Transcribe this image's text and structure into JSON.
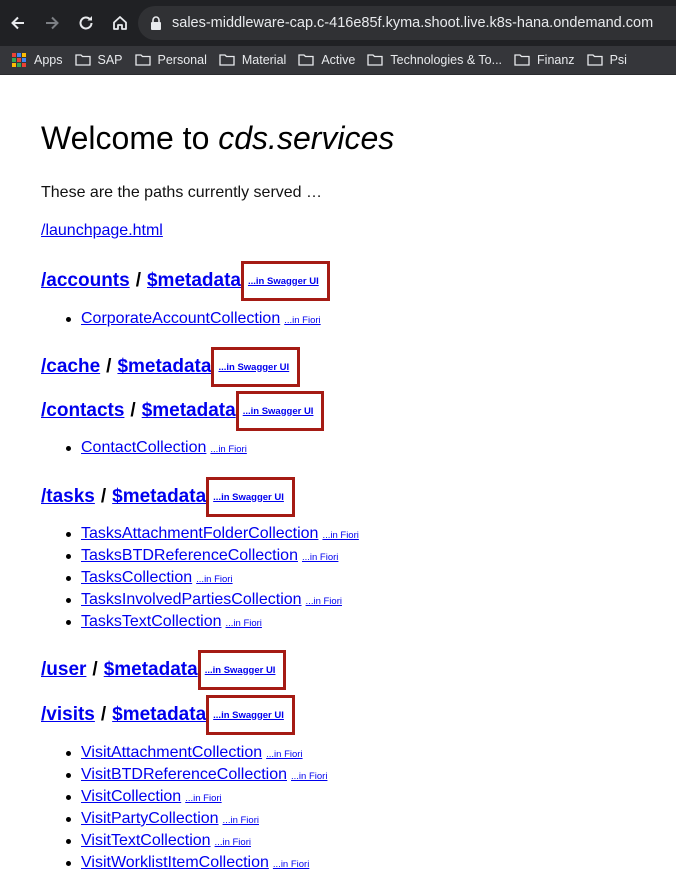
{
  "browser": {
    "url": "sales-middleware-cap.c-416e85f.kyma.shoot.live.k8s-hana.ondemand.com",
    "bookmarks": [
      "Apps",
      "SAP",
      "Personal",
      "Material",
      "Active",
      "Technologies & To...",
      "Finanz",
      "Psi"
    ]
  },
  "page": {
    "title_prefix": "Welcome to ",
    "title_em": "cds.services",
    "intro": "These are the paths currently served …",
    "launch_link": "/launchpage.html",
    "metadata_label": "$metadata",
    "slash": "/",
    "swagger_label": "...in Swagger UI",
    "fiori_label": "...in Fiori"
  },
  "services": [
    {
      "path": "/accounts",
      "entities": [
        "CorporateAccountCollection"
      ]
    },
    {
      "path": "/cache",
      "entities": []
    },
    {
      "path": "/contacts",
      "entities": [
        "ContactCollection"
      ]
    },
    {
      "path": "/tasks",
      "entities": [
        "TasksAttachmentFolderCollection",
        "TasksBTDReferenceCollection",
        "TasksCollection",
        "TasksInvolvedPartiesCollection",
        "TasksTextCollection"
      ]
    },
    {
      "path": "/user",
      "entities": []
    },
    {
      "path": "/visits",
      "entities": [
        "VisitAttachmentCollection",
        "VisitBTDReferenceCollection",
        "VisitCollection",
        "VisitPartyCollection",
        "VisitTextCollection",
        "VisitWorklistItemCollection"
      ]
    }
  ],
  "colors": {
    "link": "#0000ee",
    "highlight_box": "#a51b14",
    "chrome_bg": "#202124",
    "bookmarks_bg": "#35363a"
  }
}
